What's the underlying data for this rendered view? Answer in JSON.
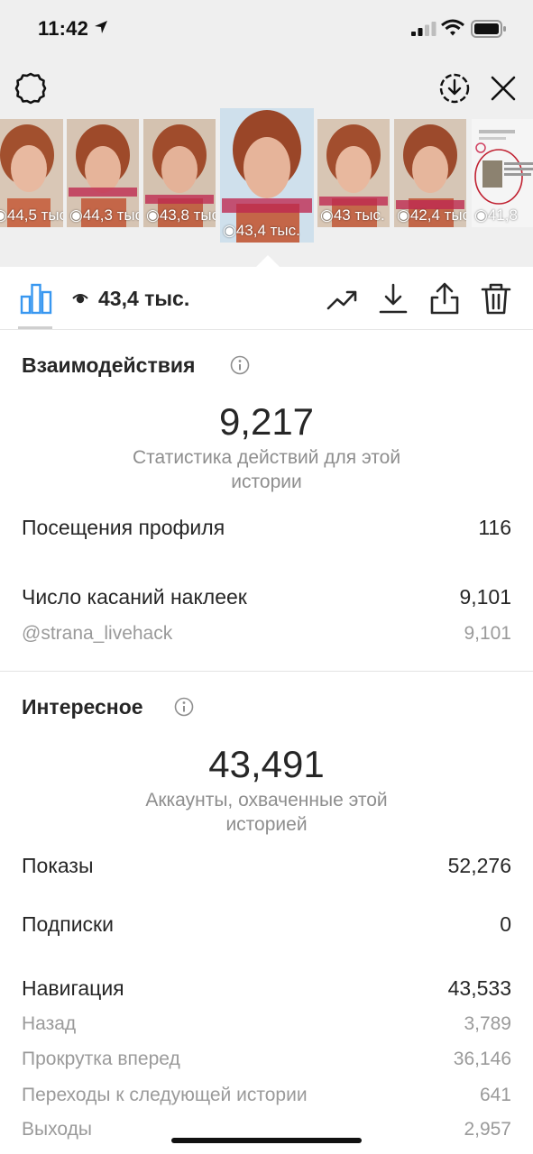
{
  "status_bar": {
    "time": "11:42"
  },
  "story_thumbnails": [
    {
      "views": "44,5 тыс."
    },
    {
      "views": "44,3 тыс."
    },
    {
      "views": "43,8 тыс."
    },
    {
      "views": "43,4 тыс."
    },
    {
      "views": "43 тыс."
    },
    {
      "views": "42,4 тыс."
    },
    {
      "views": "41,8"
    }
  ],
  "toolbar": {
    "views": "43,4 тыс."
  },
  "interactions": {
    "title": "Взаимодействия",
    "total": "9,217",
    "caption": "Статистика действий для этой истории",
    "profile_visits_label": "Посещения профиля",
    "profile_visits_value": "116",
    "sticker_taps_label": "Число касаний наклеек",
    "sticker_taps_value": "9,101",
    "mention_label": "@strana_livehack",
    "mention_value": "9,101"
  },
  "discovery": {
    "title": "Интересное",
    "total": "43,491",
    "caption": "Аккаунты, охваченные этой историей",
    "impressions_label": "Показы",
    "impressions_value": "52,276",
    "follows_label": "Подписки",
    "follows_value": "0",
    "navigation_label": "Навигация",
    "navigation_value": "43,533",
    "back_label": "Назад",
    "back_value": "3,789",
    "forward_label": "Прокрутка вперед",
    "forward_value": "36,146",
    "next_story_label": "Переходы к следующей истории",
    "next_story_value": "641",
    "exits_label": "Выходы",
    "exits_value": "2,957"
  },
  "colors": {
    "accent": "#3897f0",
    "text": "#262626",
    "muted": "#8e8e8e",
    "sticker": "#be2850"
  },
  "icons": [
    "location-arrow-icon",
    "signal-icon",
    "wifi-icon",
    "battery-icon",
    "gear-icon",
    "download-ring-icon",
    "close-icon",
    "bar-chart-icon",
    "eye-icon",
    "trend-icon",
    "download-icon",
    "share-icon",
    "trash-icon",
    "info-icon"
  ]
}
